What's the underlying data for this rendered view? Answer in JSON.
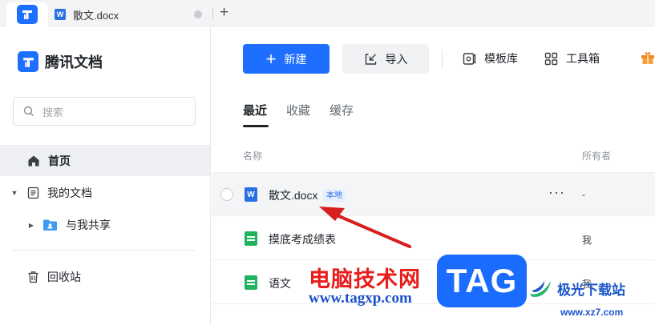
{
  "tabbar": {
    "doc_tab": {
      "title": "散文.docx",
      "icon": "word-icon"
    },
    "add_label": "+"
  },
  "sidebar": {
    "brand": "腾讯文档",
    "search_placeholder": "搜索",
    "items": [
      {
        "label": "首页",
        "icon": "home-icon",
        "active": true
      },
      {
        "label": "我的文档",
        "icon": "document-icon",
        "expanded": true
      },
      {
        "label": "与我共享",
        "icon": "shared-folder-icon",
        "expanded": false
      },
      {
        "label": "回收站",
        "icon": "trash-icon"
      }
    ]
  },
  "toolbar": {
    "new_label": "新建",
    "import_label": "导入",
    "template_label": "模板库",
    "tools_label": "工具箱"
  },
  "tabs": [
    {
      "label": "最近",
      "active": true
    },
    {
      "label": "收藏"
    },
    {
      "label": "缓存"
    }
  ],
  "table": {
    "columns": [
      "名称",
      "所有者"
    ],
    "rows": [
      {
        "name": "散文.docx",
        "badge": "本地",
        "owner": "-",
        "type": "word",
        "more": "···"
      },
      {
        "name": "摸底考成绩表",
        "owner": "我",
        "type": "sheet"
      },
      {
        "name": "语文",
        "owner": "我",
        "type": "sheet"
      }
    ]
  },
  "watermark": {
    "cn_text": "电脑技术网",
    "url": "www.tagxp.com",
    "tag": "TAG",
    "site_name": "极光下载站",
    "site_url": "www.xz7.com"
  },
  "colors": {
    "accent": "#1e6fff",
    "sheet_green": "#1fb35f",
    "arrow_red": "#d61f1f"
  }
}
